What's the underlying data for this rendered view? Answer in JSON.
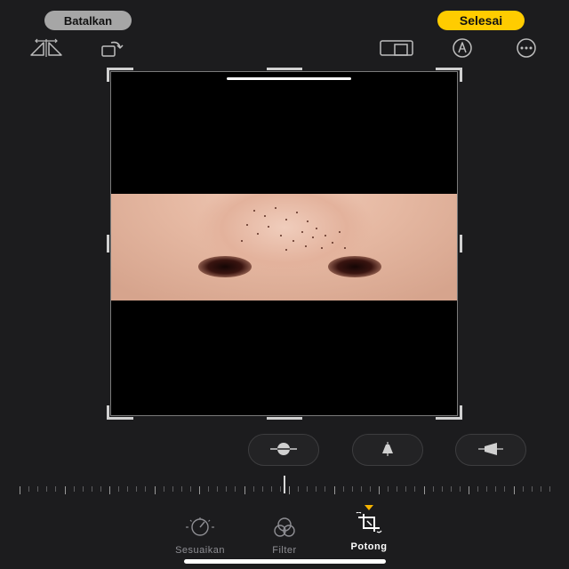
{
  "header": {
    "cancel_label": "Batalkan",
    "done_label": "Selesai"
  },
  "toolbar": {
    "left_icons": [
      "flip-horizontal-icon",
      "rotate-icon"
    ],
    "right_icons": [
      "aspect-ratio-icon",
      "markup-pen-icon",
      "more-icon"
    ]
  },
  "colors": {
    "background": "#1c1c1e",
    "accent": "#ffcc00",
    "cancel_pill": "#a6a6a6",
    "active_marker": "#f5b300"
  },
  "perspective_buttons": [
    "straighten-icon",
    "vertical-perspective-icon",
    "horizontal-perspective-icon"
  ],
  "bottom_tabs": [
    {
      "label": "Sesuaikan",
      "icon": "adjust-dial-icon",
      "active": false
    },
    {
      "label": "Filter",
      "icon": "filter-circles-icon",
      "active": false
    },
    {
      "label": "Potong",
      "icon": "crop-rotate-icon",
      "active": true
    }
  ]
}
